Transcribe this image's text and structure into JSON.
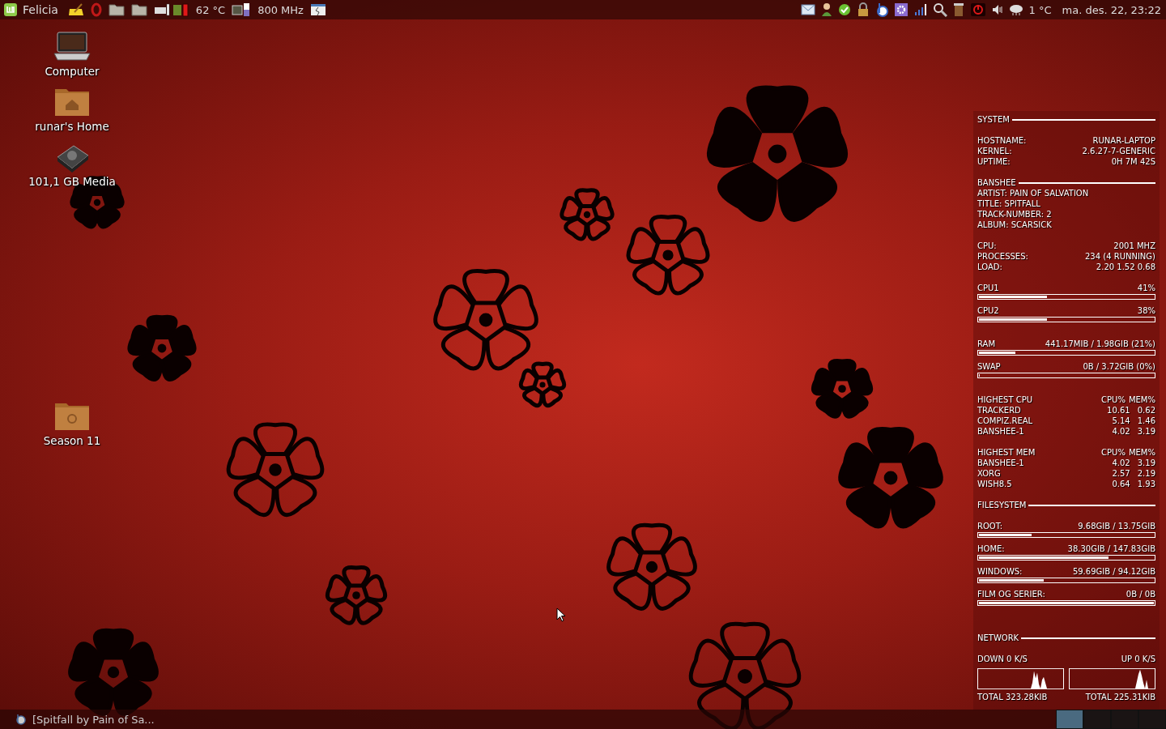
{
  "top_panel": {
    "menu_label": "Felicia",
    "temperature": "62 °C",
    "cpu_frequency": "800 MHz",
    "weather": "1 °C",
    "clock": "ma. des. 22, 23:22"
  },
  "desktop_icons": [
    {
      "label": "Computer",
      "kind": "computer"
    },
    {
      "label": "runar's Home",
      "kind": "home"
    },
    {
      "label": "101,1 GB Media",
      "kind": "drive"
    },
    {
      "label": "Season 11",
      "kind": "folder"
    }
  ],
  "conky": {
    "groups": [
      {
        "items": [
          {
            "kind": "section",
            "title": "SYSTEM"
          }
        ]
      },
      {
        "items": [
          {
            "kind": "pairs",
            "rows": [
              {
                "label": "HOSTNAME:",
                "value": "RUNAR-LAPTOP"
              },
              {
                "label": "KERNEL:",
                "value": "2.6.27-7-GENERIC"
              },
              {
                "label": "UPTIME:",
                "value": "0H 7M 42S"
              }
            ]
          }
        ]
      },
      {
        "items": [
          {
            "kind": "section",
            "title": "BANSHEE"
          },
          {
            "kind": "lines",
            "lines": [
              "ARTIST: PAIN OF SALVATION",
              "TITLE: SPITFALL",
              "TRACK-NUMBER: 2",
              "ALBUM: SCARSICK"
            ]
          }
        ]
      },
      {
        "items": [
          {
            "kind": "pairs",
            "rows": [
              {
                "label": "CPU:",
                "value": "2001 MHZ"
              },
              {
                "label": "PROCESSES:",
                "value": "234 (4 RUNNING)"
              },
              {
                "label": "LOAD:",
                "value": "2.20 1.52 0.68"
              }
            ]
          }
        ]
      },
      {
        "items": [
          {
            "kind": "bar",
            "label": "CPU1",
            "value": "41%",
            "level": 0.39
          },
          {
            "kind": "bar",
            "label": "CPU2",
            "value": "38%",
            "level": 0.39
          }
        ]
      },
      {
        "items": [
          {
            "kind": "bar",
            "label": "RAM",
            "value": "441.17MIB / 1.98GIB (21%)",
            "level": 0.21
          },
          {
            "kind": "bar",
            "label": "SWAP",
            "value": "0B / 3.72GIB (0%)",
            "level": 0
          }
        ]
      },
      {
        "items": [
          {
            "kind": "table",
            "title": "HIGHEST CPU",
            "columns": [
              "CPU%",
              "MEM%"
            ],
            "rows": [
              {
                "name": "TRACKERD",
                "cpu": "10.61",
                "mem": "0.62"
              },
              {
                "name": "COMPIZ.REAL",
                "cpu": "5.14",
                "mem": "1.46"
              },
              {
                "name": "BANSHEE-1",
                "cpu": "4.02",
                "mem": "3.19"
              }
            ]
          }
        ]
      },
      {
        "items": [
          {
            "kind": "table",
            "title": "HIGHEST MEM",
            "columns": [
              "CPU%",
              "MEM%"
            ],
            "rows": [
              {
                "name": "BANSHEE-1",
                "cpu": "4.02",
                "mem": "3.19"
              },
              {
                "name": "XORG",
                "cpu": "2.57",
                "mem": "2.19"
              },
              {
                "name": "WISH8.5",
                "cpu": "0.64",
                "mem": "1.93"
              }
            ]
          },
          {
            "kind": "section",
            "title": "FILESYSTEM"
          }
        ]
      },
      {
        "items": [
          {
            "kind": "bar",
            "label": "ROOT:",
            "value": "9.68GIB / 13.75GIB",
            "level": 0.3
          },
          {
            "kind": "bar",
            "label": "HOME:",
            "value": "38.30GIB / 147.83GIB",
            "level": 0.74
          },
          {
            "kind": "bar",
            "label": "WINDOWS:",
            "value": "59.69GIB / 94.12GIB",
            "level": 0.37
          },
          {
            "kind": "bar",
            "label": "FILM OG SERIER:",
            "value": "0B / 0B",
            "level": 1
          }
        ]
      },
      {
        "items": [
          {
            "kind": "section",
            "title": "NETWORK"
          }
        ]
      },
      {
        "items": [
          {
            "kind": "network",
            "down": "DOWN 0 K/S",
            "up": "UP 0 K/S",
            "down_total": "TOTAL 323.28KIB",
            "up_total": "TOTAL 225.31KIB"
          }
        ]
      }
    ]
  },
  "bottom_panel": {
    "task": "[Spitfall by Pain of Sa...",
    "workspaces": [
      {
        "selected": true
      },
      {
        "selected": false
      },
      {
        "selected": false
      },
      {
        "selected": false
      }
    ]
  }
}
